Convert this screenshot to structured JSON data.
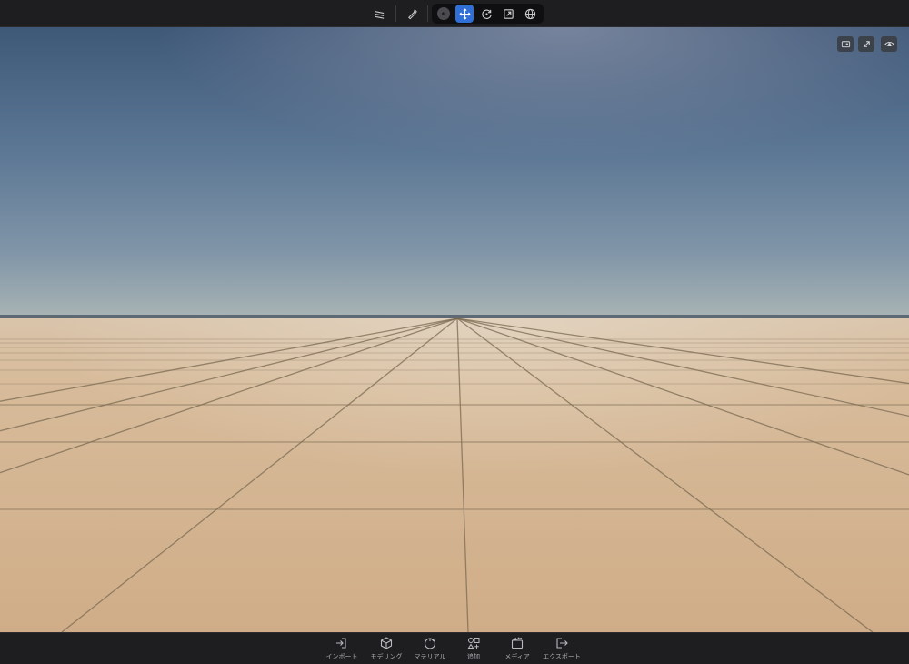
{
  "toolbar": {
    "icons": [
      "layers-icon",
      "pen-icon",
      "back-icon",
      "move-icon",
      "rotate-icon",
      "scale-icon",
      "globe-icon"
    ],
    "active_tool": "move"
  },
  "viewport": {
    "overlay_buttons": [
      "camera-icon",
      "expand-icon",
      "eye-icon"
    ],
    "colors": {
      "sky_top": "#3e5878",
      "sky_horizon": "#a9b4b4",
      "floor": "#d2b08c",
      "grout": "#7a6a52",
      "accent": "#2f6fd6"
    }
  },
  "bottombar": {
    "items": [
      {
        "label": "インポート",
        "icon": "import-icon"
      },
      {
        "label": "モデリング",
        "icon": "cube-icon"
      },
      {
        "label": "マテリアル",
        "icon": "material-icon"
      },
      {
        "label": "追加",
        "icon": "add-objects-icon"
      },
      {
        "label": "メディア",
        "icon": "media-icon"
      },
      {
        "label": "エクスポート",
        "icon": "export-icon"
      }
    ]
  }
}
